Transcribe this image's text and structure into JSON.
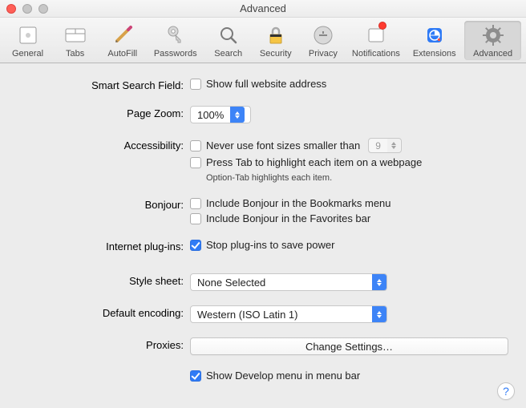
{
  "window": {
    "title": "Advanced"
  },
  "toolbar": {
    "items": [
      {
        "label": "General"
      },
      {
        "label": "Tabs"
      },
      {
        "label": "AutoFill"
      },
      {
        "label": "Passwords"
      },
      {
        "label": "Search"
      },
      {
        "label": "Security"
      },
      {
        "label": "Privacy"
      },
      {
        "label": "Notifications"
      },
      {
        "label": "Extensions"
      },
      {
        "label": "Advanced"
      }
    ]
  },
  "sections": {
    "smart_search": {
      "label": "Smart Search Field:",
      "full_url": {
        "label": "Show full website address",
        "checked": false
      }
    },
    "page_zoom": {
      "label": "Page Zoom:",
      "value": "100%"
    },
    "accessibility": {
      "label": "Accessibility:",
      "min_font": {
        "label": "Never use font sizes smaller than",
        "checked": false,
        "value": "9"
      },
      "press_tab": {
        "label": "Press Tab to highlight each item on a webpage",
        "checked": false
      },
      "hint": "Option-Tab highlights each item."
    },
    "bonjour": {
      "label": "Bonjour:",
      "bookmarks": {
        "label": "Include Bonjour in the Bookmarks menu",
        "checked": false
      },
      "favorites": {
        "label": "Include Bonjour in the Favorites bar",
        "checked": false
      }
    },
    "plugins": {
      "label": "Internet plug-ins:",
      "stop": {
        "label": "Stop plug-ins to save power",
        "checked": true
      }
    },
    "stylesheet": {
      "label": "Style sheet:",
      "value": "None Selected"
    },
    "encoding": {
      "label": "Default encoding:",
      "value": "Western (ISO Latin 1)"
    },
    "proxies": {
      "label": "Proxies:",
      "button": "Change Settings…"
    },
    "develop": {
      "label": "Show Develop menu in menu bar",
      "checked": true
    }
  },
  "help": "?"
}
